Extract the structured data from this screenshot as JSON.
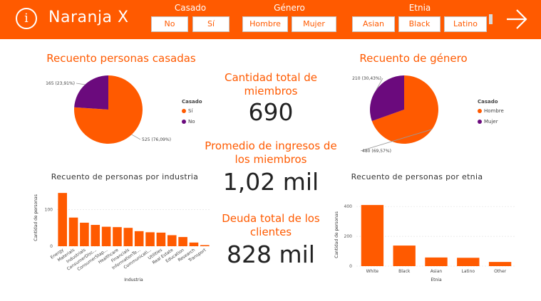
{
  "header": {
    "title": "Naranja X",
    "info_icon": "i",
    "colors": {
      "brand": "#ff5a00"
    },
    "slicers": [
      {
        "title": "Casado",
        "options": [
          "No",
          "Sí"
        ]
      },
      {
        "title": "Género",
        "options": [
          "Hombre",
          "Mujer"
        ]
      },
      {
        "title": "Etnia",
        "options": [
          "Asian",
          "Black",
          "Latino"
        ]
      }
    ]
  },
  "charts": {
    "married_title": "Recuento personas casadas",
    "gender_title": "Recuento de género",
    "industry_title": "Recuento de personas por industria",
    "ethnicity_title": "Recuento de personas por etnia"
  },
  "kpis": {
    "members_label": "Cantidad total de miembros",
    "members_value": "690",
    "income_label": "Promedio de ingresos de los miembros",
    "income_value": "1,02 mil",
    "debt_label": "Deuda total de los clientes",
    "debt_value": "828 mil"
  },
  "chart_data": [
    {
      "type": "pie",
      "title": "Recuento personas casadas",
      "legend_title": "Casado",
      "legend_position": "right",
      "slices": [
        {
          "label": "Sí",
          "value": 525,
          "data_label": "525 (76,09%)",
          "color": "#ff5a00"
        },
        {
          "label": "No",
          "value": 165,
          "data_label": "165 (23,91%)",
          "color": "#6b0a7d"
        }
      ]
    },
    {
      "type": "pie",
      "title": "Recuento de género",
      "legend_title": "Casado",
      "legend_position": "right",
      "slices": [
        {
          "label": "Hombre",
          "value": 480,
          "data_label": "480 (69,57%)",
          "color": "#ff5a00"
        },
        {
          "label": "Mujer",
          "value": 210,
          "data_label": "210 (30,43%)",
          "color": "#6b0a7d"
        }
      ]
    },
    {
      "type": "bar",
      "title": "Recuento de personas por industria",
      "xlabel": "Industria",
      "ylabel": "Cantidad de personas",
      "ylim": [
        0,
        155
      ],
      "yticks": [
        "0",
        "100"
      ],
      "grid": true,
      "categories": [
        "Energy",
        "Materials",
        "Industrials",
        "ConsumerDisc...",
        "ConsumerStap...",
        "Healthcare",
        "Financials",
        "InformationTe...",
        "Communicati...",
        "Utilities",
        "Real Estate",
        "Education",
        "Research",
        "Transport"
      ],
      "values": [
        145,
        78,
        64,
        58,
        53,
        52,
        50,
        41,
        38,
        37,
        30,
        25,
        10,
        3
      ],
      "color": "#ff5a00"
    },
    {
      "type": "bar",
      "title": "Recuento de personas por etnia",
      "xlabel": "Etnia",
      "ylabel": "Cantidad de personas",
      "ylim": [
        0,
        420
      ],
      "yticks": [
        "0",
        "200",
        "400"
      ],
      "grid": true,
      "categories": [
        "White",
        "Black",
        "Asian",
        "Latino",
        "Other"
      ],
      "values": [
        410,
        138,
        58,
        56,
        28
      ],
      "color": "#ff5a00"
    }
  ]
}
